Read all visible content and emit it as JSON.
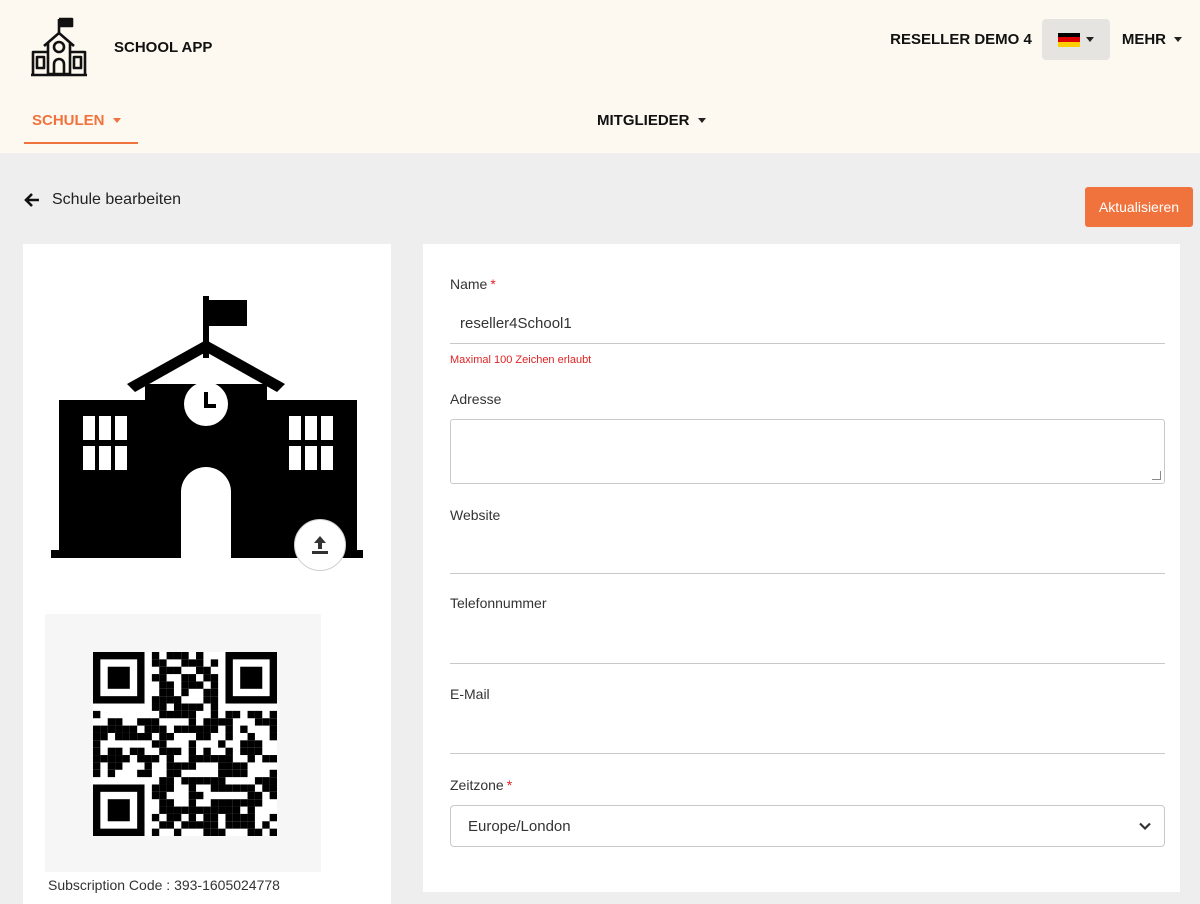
{
  "app": {
    "name": "SCHOOL APP"
  },
  "header": {
    "reseller": "RESELLER DEMO 4",
    "more_label": "MEHR",
    "flag_colors": [
      "#000000",
      "#dd0000",
      "#ffce00"
    ]
  },
  "nav": {
    "schulen": "SCHULEN",
    "mitglieder": "MITGLIEDER"
  },
  "page": {
    "back_title": "Schule bearbeiten",
    "update_button": "Aktualisieren"
  },
  "school_card": {
    "subscription_code": "Subscription Code : 393-1605024778"
  },
  "form": {
    "name_label": "Name",
    "name_required": "*",
    "name_value": "reseller4School1",
    "name_hint": "Maximal 100 Zeichen erlaubt",
    "address_label": "Adresse",
    "website_label": "Website",
    "phone_label": "Telefonnummer",
    "email_label": "E-Mail",
    "timezone_label": "Zeitzone",
    "timezone_required": "*",
    "timezone_value": "Europe/London"
  },
  "colors": {
    "accent": "#f0733d",
    "error": "#e02424",
    "topbar": "#fdf9f0"
  }
}
